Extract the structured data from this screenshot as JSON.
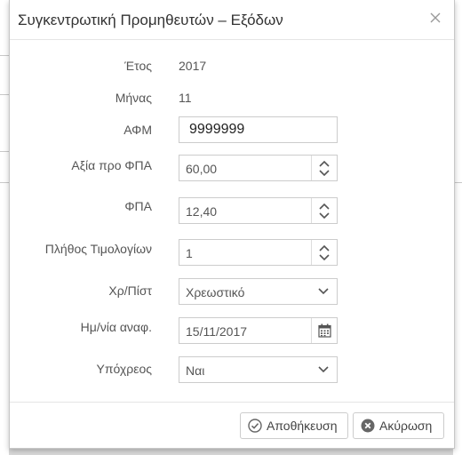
{
  "dialog": {
    "title": "Συγκεντρωτική Προμηθευτών – Εξόδων",
    "fields": {
      "year": {
        "label": "Έτος",
        "value": "2017"
      },
      "month": {
        "label": "Μήνας",
        "value": "11"
      },
      "afm": {
        "label": "ΑΦΜ",
        "value": "9999999"
      },
      "net_value": {
        "label": "Αξία προ ΦΠΑ",
        "value": "60,00"
      },
      "vat": {
        "label": "ΦΠΑ",
        "value": "12,40"
      },
      "invoice_count": {
        "label": "Πλήθος Τιμολογίων",
        "value": "1"
      },
      "debit_credit": {
        "label": "Χρ/Πίστ",
        "value": "Χρεωστικό"
      },
      "ref_date": {
        "label": "Ημ/νία αναφ.",
        "value": "15/11/2017"
      },
      "obligated": {
        "label": "Υπόχρεος",
        "value": "Ναι"
      }
    },
    "buttons": {
      "save": "Αποθήκευση",
      "cancel": "Ακύρωση"
    }
  },
  "icons": {
    "close": "close-icon",
    "spin_up": "chevron-up-icon",
    "spin_down": "chevron-down-icon",
    "select": "chevron-down-icon",
    "calendar": "calendar-icon",
    "save": "check-circle-icon",
    "cancel": "x-circle-icon"
  }
}
